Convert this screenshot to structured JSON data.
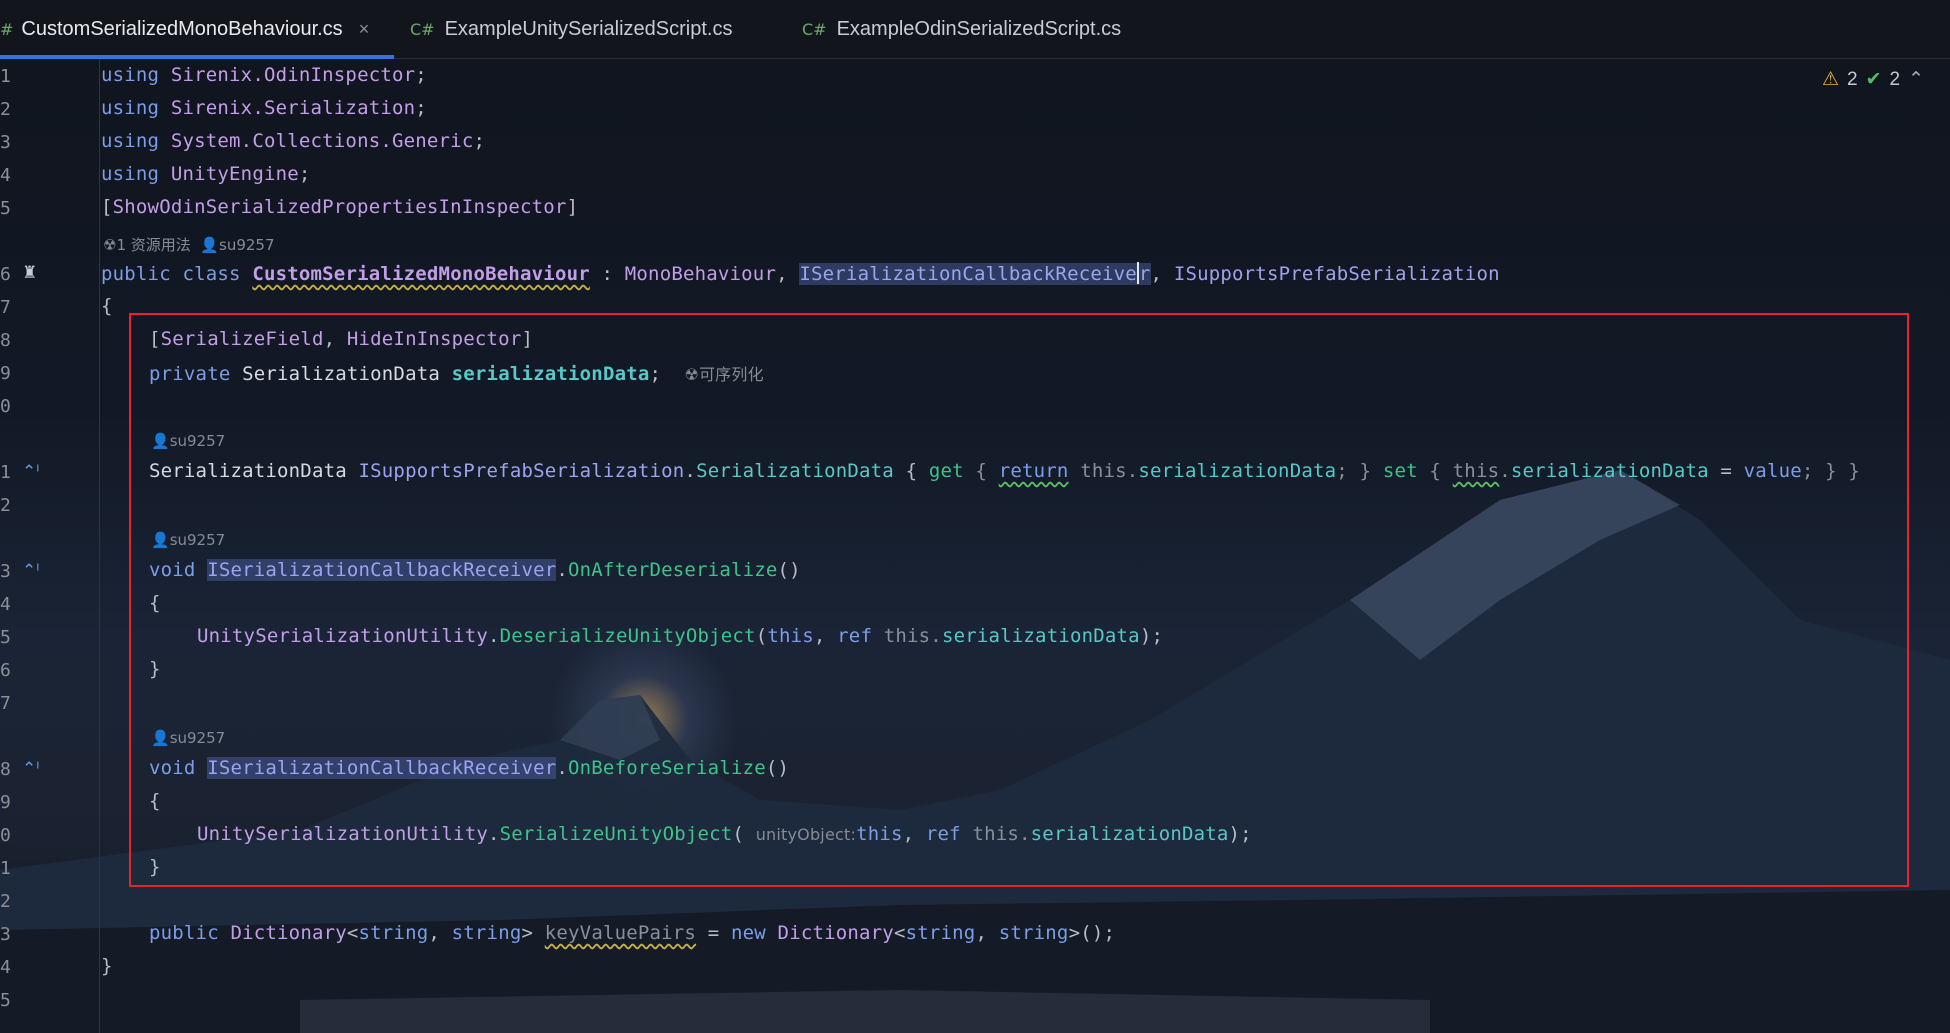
{
  "tabs": [
    {
      "lang": "#",
      "label": "CustomSerializedMonoBehaviour.cs",
      "active": true
    },
    {
      "lang": "C#",
      "label": "ExampleUnitySerializedScript.cs"
    },
    {
      "lang": "C#",
      "label": "ExampleOdinSerializedScript.cs"
    }
  ],
  "close_glyph": "×",
  "status": {
    "warnings": "2",
    "ok": "2"
  },
  "line_numbers": [
    "1",
    "2",
    "3",
    "4",
    "5",
    "6",
    "7",
    "8",
    "9",
    "0",
    "1",
    "2",
    "3",
    "4",
    "5",
    "6",
    "7",
    "8",
    "9",
    "0",
    "1",
    "2",
    "3",
    "4",
    "5"
  ],
  "hints": {
    "class_usage": "1 资源用法",
    "author": "su9257",
    "serializable": "可序列化",
    "param_name": "unityObject:"
  },
  "code": {
    "l1": {
      "kw": "using",
      "ns": "Sirenix.OdinInspector",
      "end": ";"
    },
    "l2": {
      "kw": "using",
      "ns": "Sirenix.Serialization",
      "end": ";"
    },
    "l3": {
      "kw": "using",
      "ns": "System.Collections.Generic",
      "end": ";"
    },
    "l4": {
      "kw": "using",
      "ns": "UnityEngine",
      "end": ";"
    },
    "l5": {
      "open": "[",
      "attr": "ShowOdinSerializedPropertiesInInspector",
      "close": "]"
    },
    "l6": {
      "kw1": "public",
      "kw2": "class",
      "name": "CustomSerializedMonoBehaviour",
      "colon": " : ",
      "base": "MonoBehaviour",
      "comma1": ", ",
      "if1": "ISerializationCallbackReceive",
      "if1_tail": "r",
      "comma2": ", ",
      "if2": "ISupportsPrefabSerialization"
    },
    "l7": "{",
    "l8": {
      "open": "[",
      "a1": "SerializeField",
      "comma": ", ",
      "a2": "HideInInspector",
      "close": "]"
    },
    "l9": {
      "kw": "private",
      "type": "SerializationData",
      "field": "serializationData",
      "end": ";"
    },
    "l11": {
      "type": "SerializationData",
      "iface": "ISupportsPrefabSerialization",
      "dot": ".",
      "prop": "SerializationData",
      "b1": " { ",
      "get": "get",
      "b2": " { ",
      "ret": "return",
      "this1": "this.",
      "f1": "serializationData",
      "e1": "; } ",
      "set": "set",
      "b3": " { ",
      "this2": "this",
      "dot2": ".",
      "f2": "serializationData",
      "eq": " = ",
      "val": "value",
      "e2": "; } }"
    },
    "l13": {
      "kw": "void",
      "iface": "ISerializationCallbackReceiver",
      "dot": ".",
      "fn": "OnAfterDeserialize",
      "paren": "()"
    },
    "l14": "{",
    "l15": {
      "cls": "UnitySerializationUtility",
      "dot": ".",
      "fn": "DeserializeUnityObject",
      "p1": "(",
      "this": "this",
      "c": ", ",
      "ref": "ref",
      "this2": " this.",
      "f": "serializationData",
      "end": ");"
    },
    "l16": "}",
    "l18": {
      "kw": "void",
      "iface": "ISerializationCallbackReceiver",
      "dot": ".",
      "fn": "OnBeforeSerialize",
      "paren": "()"
    },
    "l19": "{",
    "l20": {
      "cls": "UnitySerializationUtility",
      "dot": ".",
      "fn": "SerializeUnityObject",
      "p1": "(",
      "this": "this",
      "c": ", ",
      "ref": "ref",
      "this2": " this.",
      "f": "serializationData",
      "end": ");"
    },
    "l21": "}",
    "l23": {
      "kw": "public",
      "type": "Dictionary",
      "g1": "<",
      "s1": "string",
      "c": ", ",
      "s2": "string",
      "g2": "> ",
      "field": "keyValuePairs",
      "eq": " = ",
      "new": "new",
      "type2": " Dictionary",
      "g3": "<",
      "s3": "string",
      "c2": ", ",
      "s4": "string",
      "g4": ">();"
    },
    "l24": "}"
  },
  "colors": {
    "accent": "#3874d8",
    "highlight_box": "#e8232e",
    "warning": "#e1b33d",
    "ok": "#4fbf6b"
  }
}
